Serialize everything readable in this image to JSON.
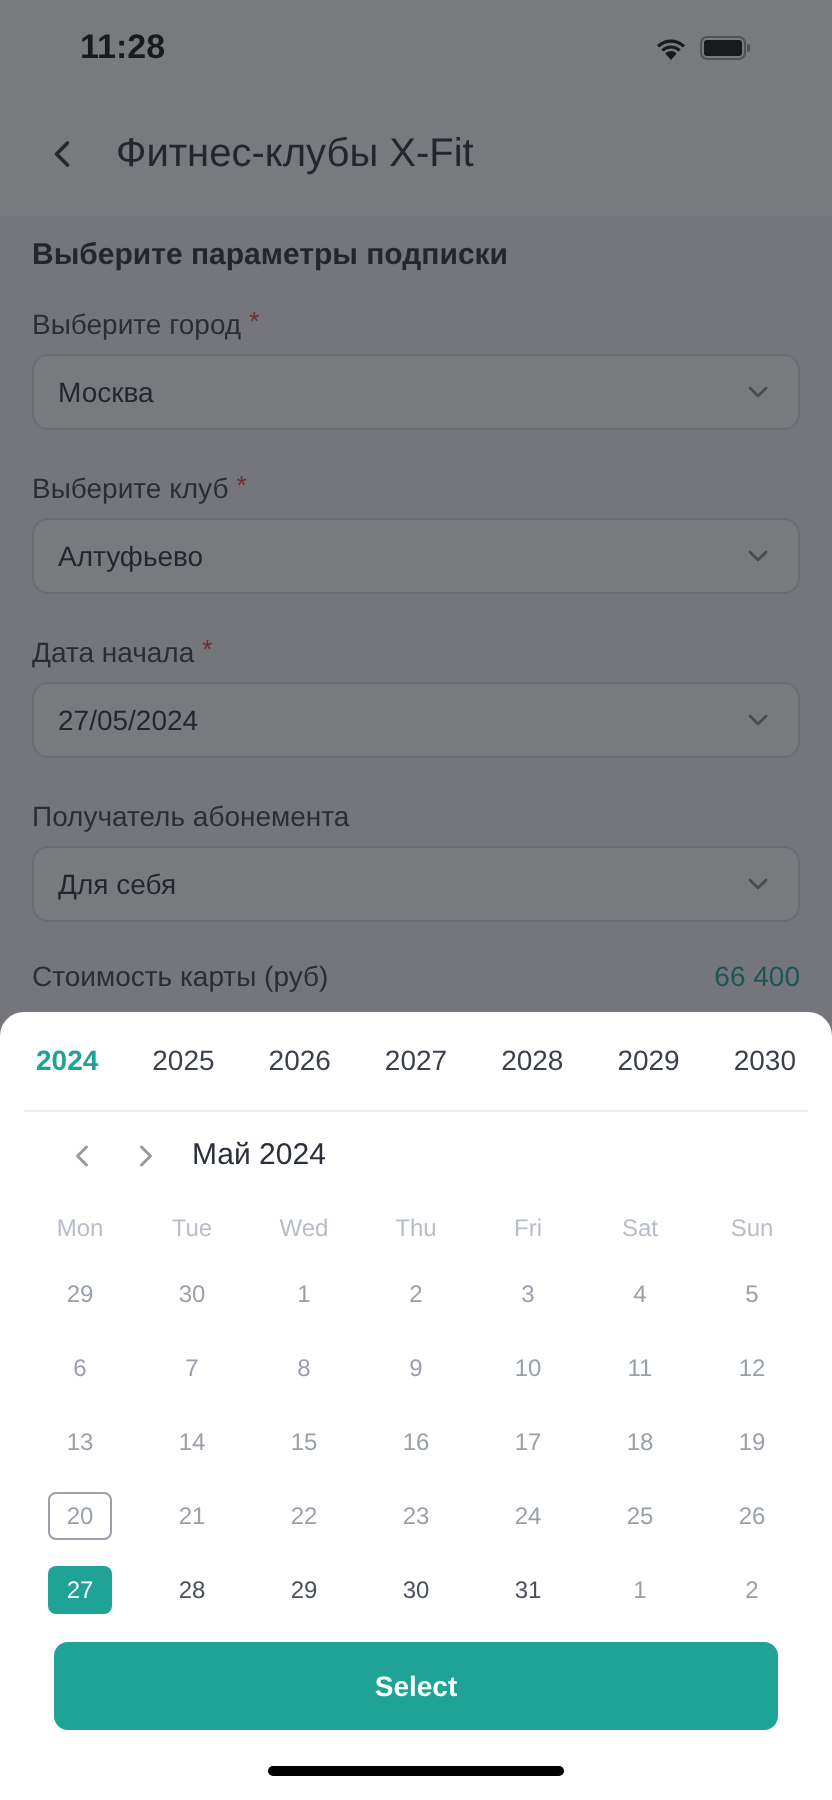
{
  "status_bar": {
    "time": "11:28"
  },
  "header": {
    "title": "Фитнес-клубы X-Fit"
  },
  "form": {
    "heading": "Выберите параметры подписки",
    "required_mark": "*",
    "fields": [
      {
        "label": "Выберите город",
        "required": true,
        "value": "Москва"
      },
      {
        "label": "Выберите клуб",
        "required": true,
        "value": "Алтуфьево"
      },
      {
        "label": "Дата начала",
        "required": true,
        "value": "27/05/2024"
      },
      {
        "label": "Получатель абонемента",
        "required": false,
        "value": "Для себя"
      }
    ],
    "price": {
      "label": "Стоимость карты (руб)",
      "value": "66 400"
    }
  },
  "date_picker": {
    "years": [
      {
        "label": "2024",
        "selected": true
      },
      {
        "label": "2025",
        "selected": false
      },
      {
        "label": "2026",
        "selected": false
      },
      {
        "label": "2027",
        "selected": false
      },
      {
        "label": "2028",
        "selected": false
      },
      {
        "label": "2029",
        "selected": false
      },
      {
        "label": "2030",
        "selected": false
      }
    ],
    "month": "Май 2024",
    "weekdays": [
      "Mon",
      "Tue",
      "Wed",
      "Thu",
      "Fri",
      "Sat",
      "Sun"
    ],
    "weeks": [
      [
        {
          "day": "29",
          "disabled": true,
          "selected": false,
          "today": false
        },
        {
          "day": "30",
          "disabled": true,
          "selected": false,
          "today": false
        },
        {
          "day": "1",
          "disabled": true,
          "selected": false,
          "today": false
        },
        {
          "day": "2",
          "disabled": true,
          "selected": false,
          "today": false
        },
        {
          "day": "3",
          "disabled": true,
          "selected": false,
          "today": false
        },
        {
          "day": "4",
          "disabled": true,
          "selected": false,
          "today": false
        },
        {
          "day": "5",
          "disabled": true,
          "selected": false,
          "today": false
        }
      ],
      [
        {
          "day": "6",
          "disabled": true,
          "selected": false,
          "today": false
        },
        {
          "day": "7",
          "disabled": true,
          "selected": false,
          "today": false
        },
        {
          "day": "8",
          "disabled": true,
          "selected": false,
          "today": false
        },
        {
          "day": "9",
          "disabled": true,
          "selected": false,
          "today": false
        },
        {
          "day": "10",
          "disabled": true,
          "selected": false,
          "today": false
        },
        {
          "day": "11",
          "disabled": true,
          "selected": false,
          "today": false
        },
        {
          "day": "12",
          "disabled": true,
          "selected": false,
          "today": false
        }
      ],
      [
        {
          "day": "13",
          "disabled": true,
          "selected": false,
          "today": false
        },
        {
          "day": "14",
          "disabled": true,
          "selected": false,
          "today": false
        },
        {
          "day": "15",
          "disabled": true,
          "selected": false,
          "today": false
        },
        {
          "day": "16",
          "disabled": true,
          "selected": false,
          "today": false
        },
        {
          "day": "17",
          "disabled": true,
          "selected": false,
          "today": false
        },
        {
          "day": "18",
          "disabled": true,
          "selected": false,
          "today": false
        },
        {
          "day": "19",
          "disabled": true,
          "selected": false,
          "today": false
        }
      ],
      [
        {
          "day": "20",
          "disabled": true,
          "selected": false,
          "today": true
        },
        {
          "day": "21",
          "disabled": true,
          "selected": false,
          "today": false
        },
        {
          "day": "22",
          "disabled": true,
          "selected": false,
          "today": false
        },
        {
          "day": "23",
          "disabled": true,
          "selected": false,
          "today": false
        },
        {
          "day": "24",
          "disabled": true,
          "selected": false,
          "today": false
        },
        {
          "day": "25",
          "disabled": true,
          "selected": false,
          "today": false
        },
        {
          "day": "26",
          "disabled": true,
          "selected": false,
          "today": false
        }
      ],
      [
        {
          "day": "27",
          "disabled": false,
          "selected": true,
          "today": false
        },
        {
          "day": "28",
          "disabled": false,
          "selected": false,
          "today": false
        },
        {
          "day": "29",
          "disabled": false,
          "selected": false,
          "today": false
        },
        {
          "day": "30",
          "disabled": false,
          "selected": false,
          "today": false
        },
        {
          "day": "31",
          "disabled": false,
          "selected": false,
          "today": false
        },
        {
          "day": "1",
          "disabled": true,
          "selected": false,
          "today": false
        },
        {
          "day": "2",
          "disabled": true,
          "selected": false,
          "today": false
        }
      ]
    ],
    "button": "Select"
  }
}
